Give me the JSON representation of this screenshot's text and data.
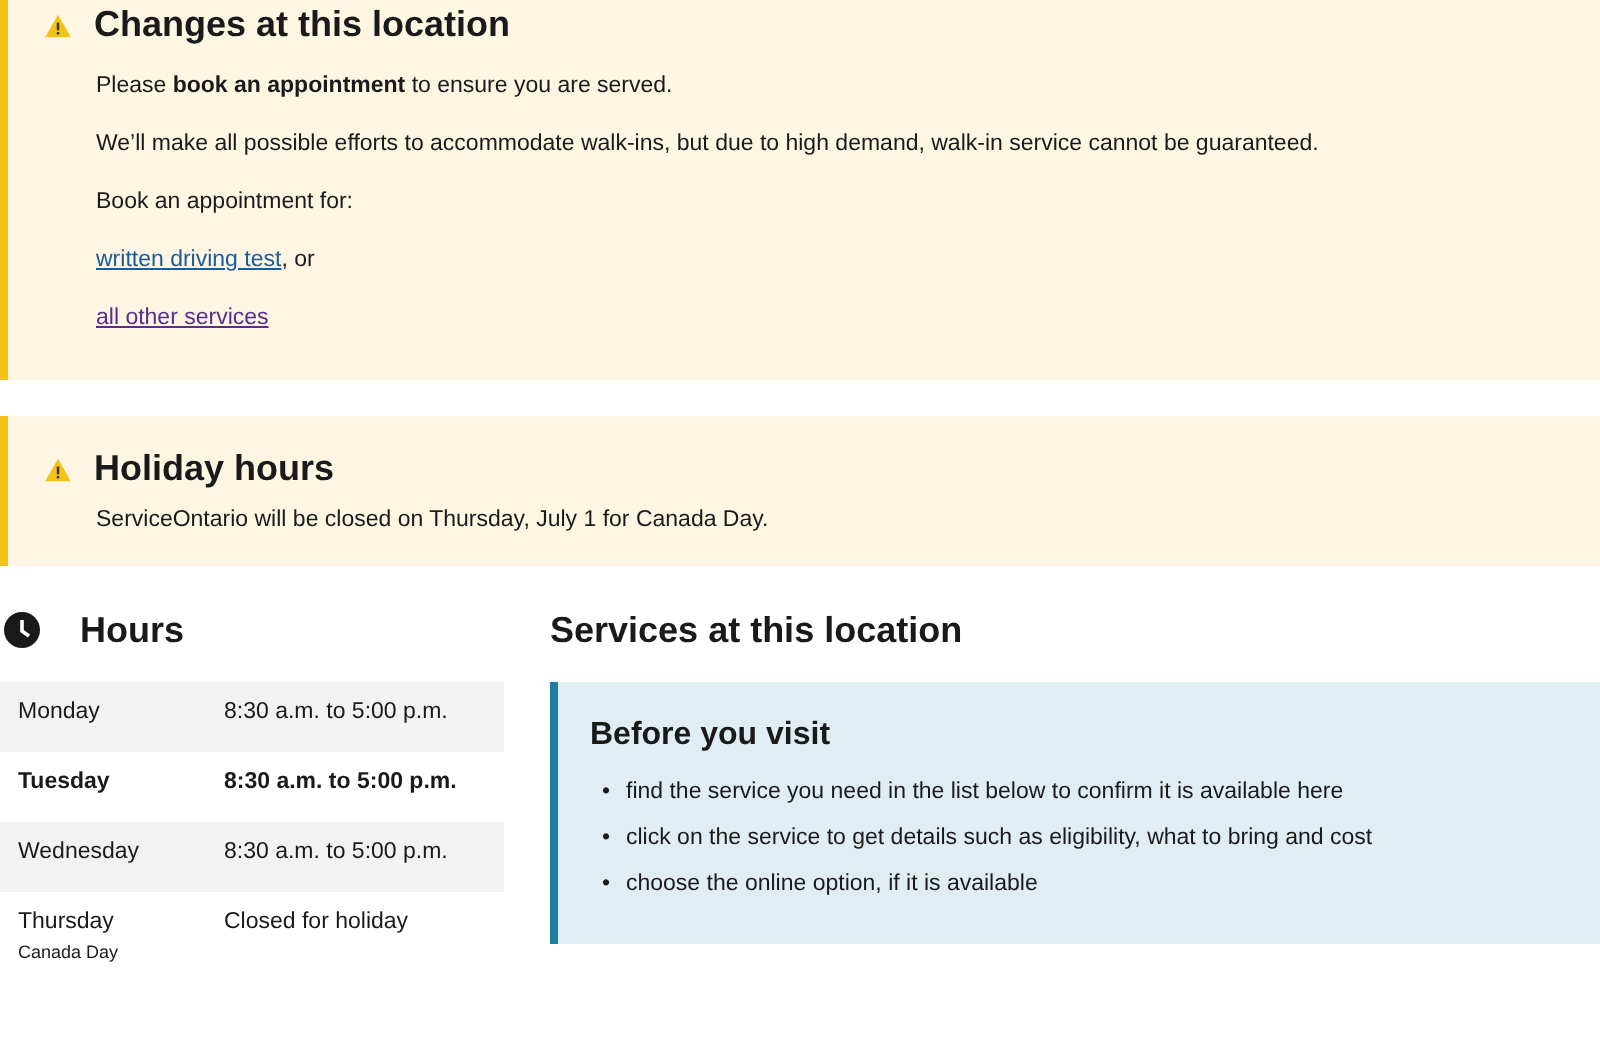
{
  "alerts": [
    {
      "title": "Changes at this location",
      "paragraphs": [
        "Please **book an appointment** to ensure you are served.",
        "We’ll make all possible efforts to accommodate walk-ins, but due to high demand, walk-in service cannot be guaranteed.",
        "Book an appointment for:"
      ],
      "links": [
        {
          "label": "written driving test",
          "suffix": ", or",
          "visited": false
        },
        {
          "label": "all other services",
          "visited": true
        }
      ]
    },
    {
      "title": "Holiday hours",
      "paragraphs": [
        "ServiceOntario will be closed on Thursday, July 1 for Canada Day."
      ]
    }
  ],
  "hours": {
    "title": "Hours",
    "rows": [
      {
        "day": "Monday",
        "time": "8:30 a.m. to 5:00 p.m.",
        "selected": false
      },
      {
        "day": "Tuesday",
        "time": "8:30 a.m. to 5:00 p.m.",
        "selected": true
      },
      {
        "day": "Wednesday",
        "time": "8:30 a.m. to 5:00 p.m.",
        "selected": false
      },
      {
        "day": "Thursday",
        "time": "Closed for holiday",
        "note": "Canada Day",
        "selected": false
      }
    ]
  },
  "services": {
    "title": "Services at this location",
    "notice": {
      "title": "Before you visit",
      "bullet": "•",
      "items": [
        "find the service you need in the list below to confirm it is available here",
        "click on the service to get details such as eligibility, what to bring and cost",
        "choose the online option, if it is available"
      ]
    }
  }
}
